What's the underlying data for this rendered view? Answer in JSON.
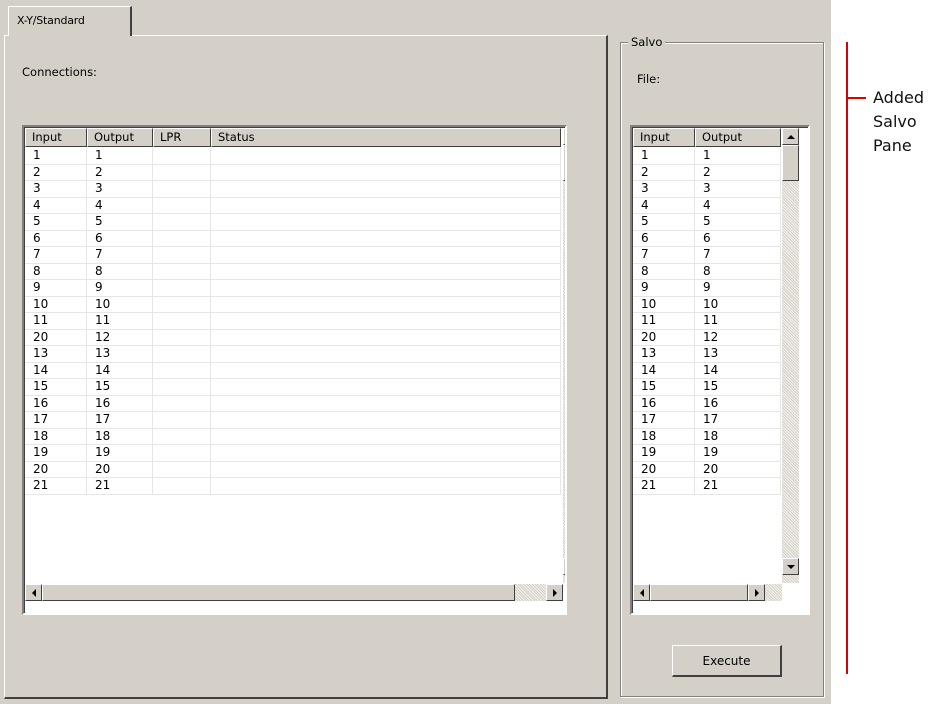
{
  "tab": {
    "label": "X-Y/Standard"
  },
  "connections": {
    "label": "Connections:",
    "columns": [
      "Input",
      "Output",
      "LPR",
      "Status"
    ],
    "rows": [
      [
        "1",
        "1",
        "",
        ""
      ],
      [
        "2",
        "2",
        "",
        ""
      ],
      [
        "3",
        "3",
        "",
        ""
      ],
      [
        "4",
        "4",
        "",
        ""
      ],
      [
        "5",
        "5",
        "",
        ""
      ],
      [
        "6",
        "6",
        "",
        ""
      ],
      [
        "7",
        "7",
        "",
        ""
      ],
      [
        "8",
        "8",
        "",
        ""
      ],
      [
        "9",
        "9",
        "",
        ""
      ],
      [
        "10",
        "10",
        "",
        ""
      ],
      [
        "11",
        "11",
        "",
        ""
      ],
      [
        "20",
        "12",
        "",
        ""
      ],
      [
        "13",
        "13",
        "",
        ""
      ],
      [
        "14",
        "14",
        "",
        ""
      ],
      [
        "15",
        "15",
        "",
        ""
      ],
      [
        "16",
        "16",
        "",
        ""
      ],
      [
        "17",
        "17",
        "",
        ""
      ],
      [
        "18",
        "18",
        "",
        ""
      ],
      [
        "19",
        "19",
        "",
        ""
      ],
      [
        "20",
        "20",
        "",
        ""
      ],
      [
        "21",
        "21",
        "",
        ""
      ]
    ]
  },
  "salvo": {
    "title": "Salvo",
    "file_label": "File:",
    "columns": [
      "Input",
      "Output"
    ],
    "rows": [
      [
        "1",
        "1"
      ],
      [
        "2",
        "2"
      ],
      [
        "3",
        "3"
      ],
      [
        "4",
        "4"
      ],
      [
        "5",
        "5"
      ],
      [
        "6",
        "6"
      ],
      [
        "7",
        "7"
      ],
      [
        "8",
        "8"
      ],
      [
        "9",
        "9"
      ],
      [
        "10",
        "10"
      ],
      [
        "11",
        "11"
      ],
      [
        "20",
        "12"
      ],
      [
        "13",
        "13"
      ],
      [
        "14",
        "14"
      ],
      [
        "15",
        "15"
      ],
      [
        "16",
        "16"
      ],
      [
        "17",
        "17"
      ],
      [
        "18",
        "18"
      ],
      [
        "19",
        "19"
      ],
      [
        "20",
        "20"
      ],
      [
        "21",
        "21"
      ]
    ],
    "execute_label": "Execute"
  },
  "annotation": {
    "lines": [
      "Added",
      "Salvo",
      "Pane"
    ],
    "color": "#d80000"
  },
  "icons": [
    "scroll-up-icon",
    "scroll-down-icon",
    "scroll-left-icon",
    "scroll-right-icon"
  ],
  "colors": {
    "window_bg": "#d4d0c8",
    "list_bg": "#ffffff"
  }
}
